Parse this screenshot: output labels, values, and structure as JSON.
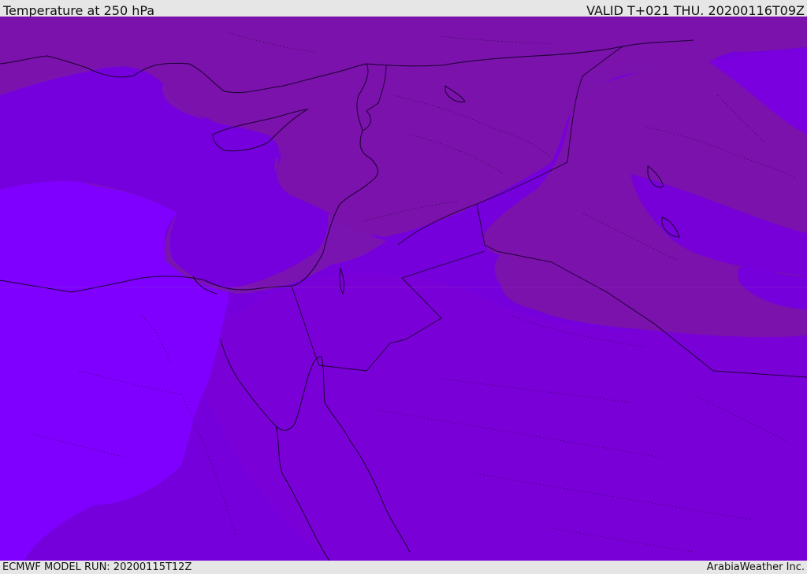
{
  "header": {
    "title": "Temperature at 250 hPa",
    "valid": "VALID T+021 THU. 20200116T09Z"
  },
  "footer": {
    "model_run": "ECMWF MODEL RUN: 20200115T12Z",
    "provider": "ArabiaWeather Inc."
  },
  "map": {
    "parameter": "temperature",
    "level": "250 hPa",
    "colors": {
      "band_cold": "#7a12a8",
      "band_mid": "#7700dd",
      "band_warm": "#7f00ff",
      "band_south": "#7a00e0",
      "coastline": "#1a0030"
    }
  }
}
